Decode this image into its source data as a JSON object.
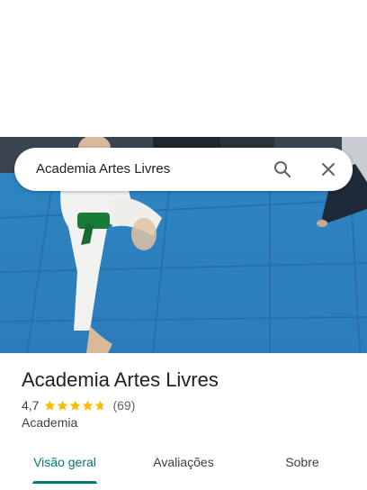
{
  "search": {
    "query": "Academia Artes Livres",
    "search_icon": "search-icon",
    "close_icon": "close-icon"
  },
  "hero_photo": {
    "description_icon": "photo"
  },
  "place": {
    "name": "Academia Artes Livres",
    "rating": "4,7",
    "stars": 4.7,
    "reviews": "(69)",
    "category": "Academia"
  },
  "tabs": [
    {
      "label": "Visão geral",
      "active": true
    },
    {
      "label": "Avaliações",
      "active": false
    },
    {
      "label": "Sobre",
      "active": false
    }
  ],
  "colors": {
    "accent": "#01796f",
    "star": "#fbbc04",
    "mat": "#2a7fbf"
  }
}
